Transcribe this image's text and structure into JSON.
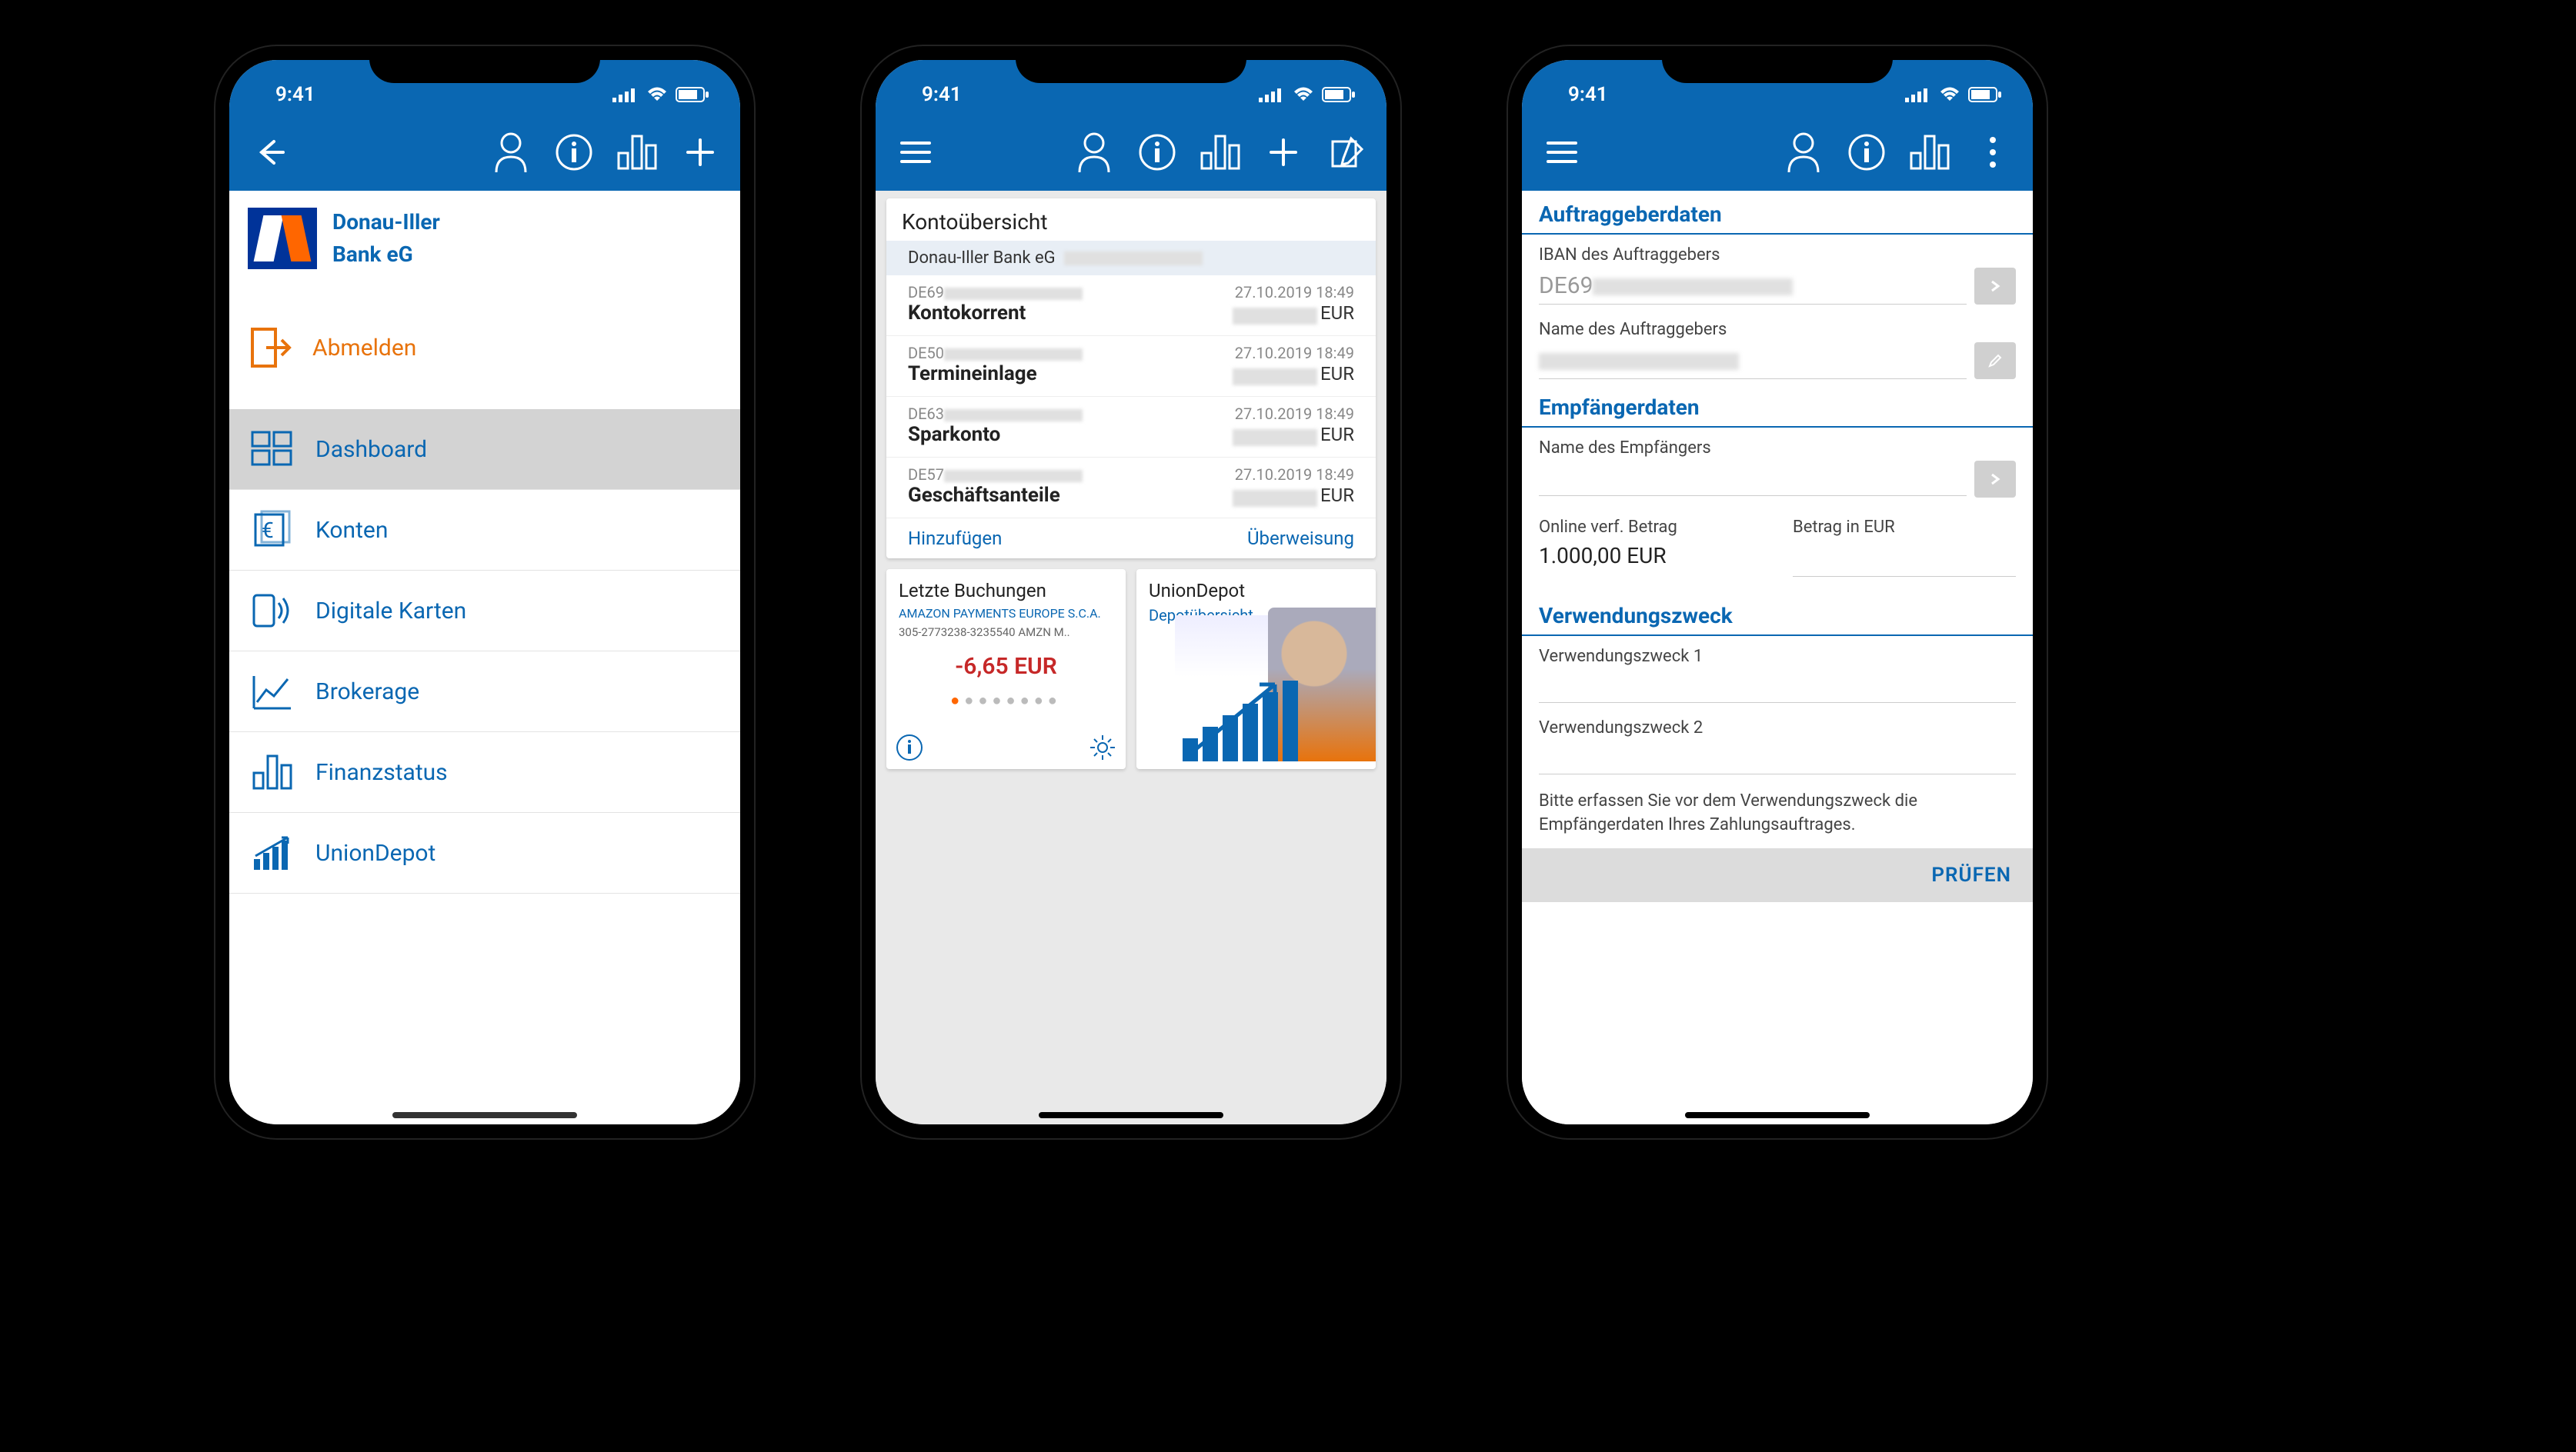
{
  "status": {
    "time": "9:41"
  },
  "phone1": {
    "bank_line1": "Donau-Iller",
    "bank_line2": "Bank eG",
    "logout": "Abmelden",
    "menu": [
      {
        "label": "Dashboard",
        "selected": true
      },
      {
        "label": "Konten"
      },
      {
        "label": "Digitale Karten"
      },
      {
        "label": "Brokerage"
      },
      {
        "label": "Finanzstatus"
      },
      {
        "label": "UnionDepot"
      }
    ]
  },
  "phone2": {
    "overview_title": "Kontoübersicht",
    "bank_header": "Donau-Iller  Bank eG",
    "accounts": [
      {
        "iban_prefix": "DE69",
        "name": "Kontokorrent",
        "timestamp": "27.10.2019 18:49",
        "currency": "EUR"
      },
      {
        "iban_prefix": "DE50",
        "name": "Termineinlage",
        "timestamp": "27.10.2019 18:49",
        "currency": "EUR"
      },
      {
        "iban_prefix": "DE63",
        "name": "Sparkonto",
        "timestamp": "27.10.2019 18:49",
        "currency": "EUR"
      },
      {
        "iban_prefix": "DE57",
        "name": "Geschäftsanteile",
        "timestamp": "27.10.2019 18:49",
        "currency": "EUR"
      }
    ],
    "add_label": "Hinzufügen",
    "transfer_label": "Überweisung",
    "tile1": {
      "title": "Letzte Buchungen",
      "sub": "AMAZON PAYMENTS EUROPE S.C.A.",
      "sub2": "305-2773238-3235540 AMZN M..",
      "amount": "-6,65 EUR"
    },
    "tile2": {
      "title": "UnionDepot",
      "link": "Depotübersicht"
    }
  },
  "phone3": {
    "sec1": "Auftraggeberdaten",
    "iban_label": "IBAN des Auftraggebers",
    "iban_value": "DE69",
    "name_label": "Name des Auftraggebers",
    "sec2": "Empfängerdaten",
    "recipient_label": "Name des Empfängers",
    "avail_label": "Online verf. Betrag",
    "avail_value": "1.000,00 EUR",
    "amount_label": "Betrag in EUR",
    "sec3": "Verwendungszweck",
    "purpose1": "Verwendungszweck 1",
    "purpose2": "Verwendungszweck 2",
    "hint": "Bitte erfassen Sie vor dem Verwendungszweck die Empfängerdaten Ihres Zahlungsauftrages.",
    "check": "PRÜFEN"
  }
}
